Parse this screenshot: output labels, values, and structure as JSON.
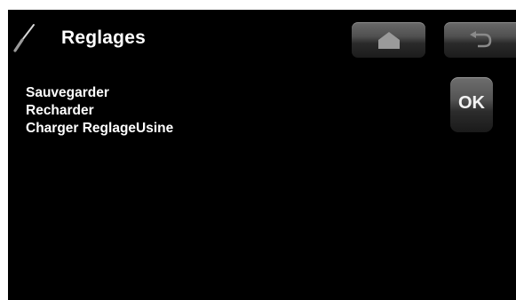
{
  "header": {
    "title": "Reglages",
    "icon": "screwdriver-icon"
  },
  "nav": {
    "home_icon": "home-icon",
    "back_icon": "back-arrow-icon"
  },
  "menu": {
    "items": [
      {
        "label": "Sauvegarder"
      },
      {
        "label": "Recharder"
      },
      {
        "label": "Charger ReglageUsine"
      }
    ]
  },
  "ok_button": {
    "label": "OK"
  },
  "colors": {
    "background": "#000000",
    "text": "#ffffff",
    "button": "#4a4a4a"
  }
}
